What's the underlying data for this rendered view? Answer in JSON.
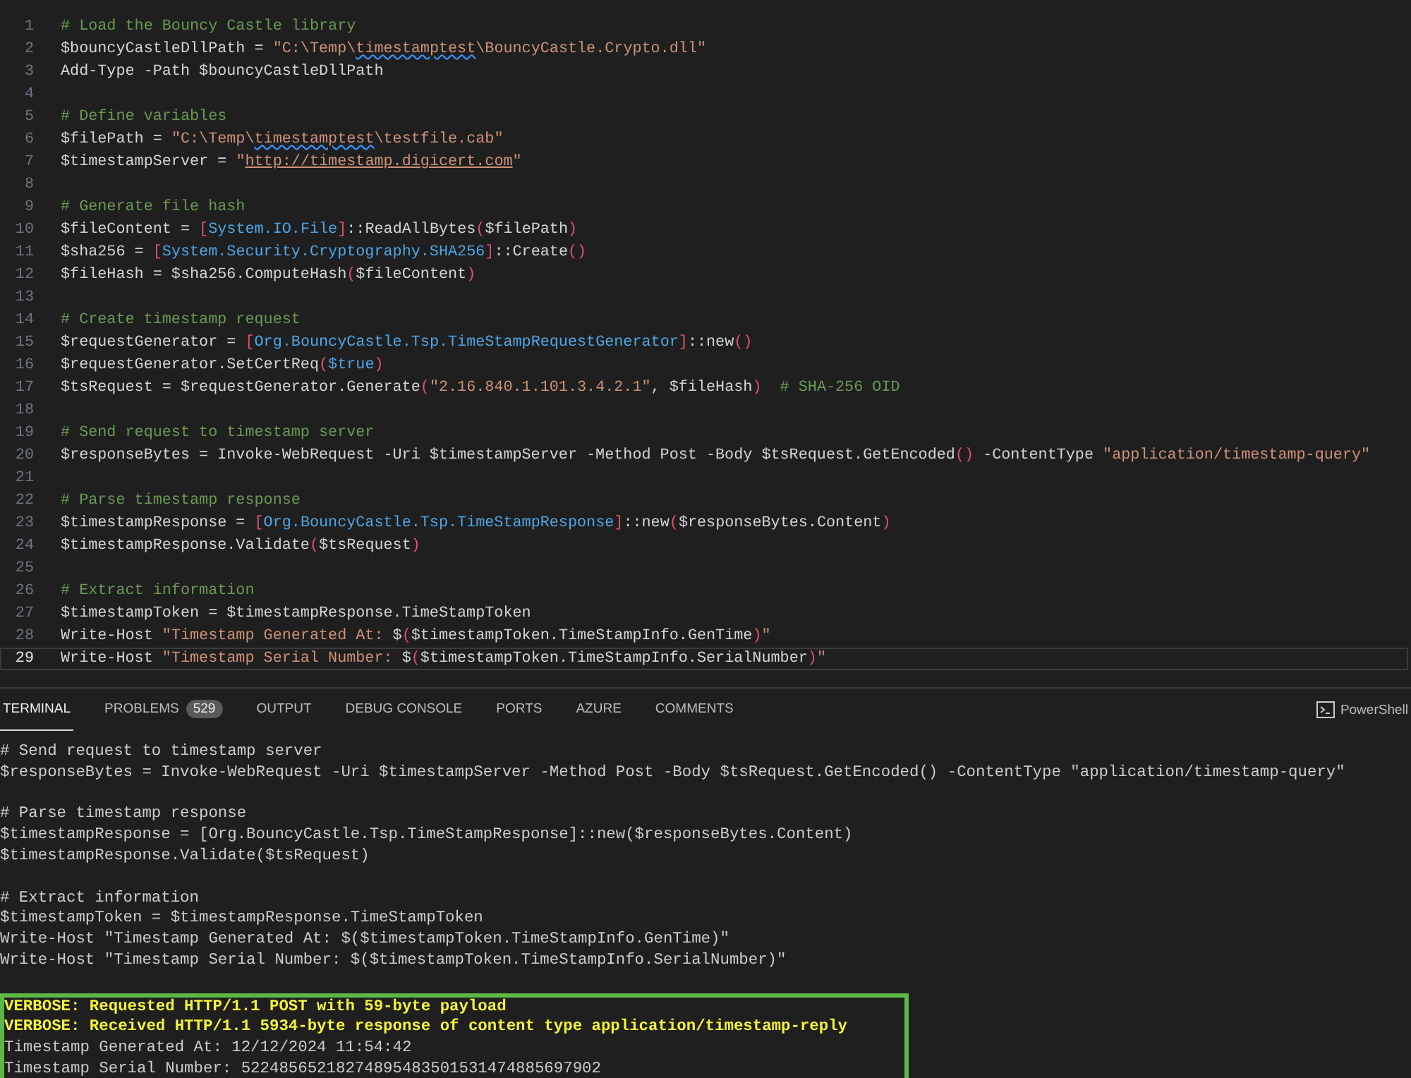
{
  "editor": {
    "lines": [
      {
        "number": "1",
        "current": false,
        "tokens": [
          {
            "kind": "comment",
            "text": "# Load the Bouncy Castle library"
          }
        ]
      },
      {
        "number": "2",
        "current": false,
        "tokens": [
          {
            "kind": "text",
            "text": "$bouncyCastleDllPath = "
          },
          {
            "kind": "string",
            "text": "\"C:\\Temp\\"
          },
          {
            "kind": "squiggle",
            "text": "timestamptest"
          },
          {
            "kind": "string",
            "text": "\\BouncyCastle.Crypto.dll\""
          }
        ]
      },
      {
        "number": "3",
        "current": false,
        "tokens": [
          {
            "kind": "text",
            "text": "Add-Type -Path $bouncyCastleDllPath"
          }
        ]
      },
      {
        "number": "4",
        "current": false
      },
      {
        "number": "5",
        "current": false,
        "tokens": [
          {
            "kind": "comment",
            "text": "# Define variables"
          }
        ]
      },
      {
        "number": "6",
        "current": false,
        "tokens": [
          {
            "kind": "text",
            "text": "$filePath = "
          },
          {
            "kind": "string",
            "text": "\"C:\\Temp\\"
          },
          {
            "kind": "squiggle",
            "text": "timestamptest"
          },
          {
            "kind": "string",
            "text": "\\testfile.cab\""
          }
        ]
      },
      {
        "number": "7",
        "current": false,
        "tokens": [
          {
            "kind": "text",
            "text": "$timestampServer = "
          },
          {
            "kind": "string",
            "text": "\""
          },
          {
            "kind": "link",
            "text": "http://timestamp.digicert.com"
          },
          {
            "kind": "string",
            "text": "\""
          }
        ]
      },
      {
        "number": "8",
        "current": false
      },
      {
        "number": "9",
        "current": false,
        "tokens": [
          {
            "kind": "comment",
            "text": "# Generate file hash"
          }
        ]
      },
      {
        "number": "10",
        "current": false,
        "tokens": [
          {
            "kind": "text",
            "text": "$fileContent = "
          },
          {
            "kind": "bracket",
            "text": "["
          },
          {
            "kind": "type",
            "text": "System.IO.File"
          },
          {
            "kind": "bracket",
            "text": "]"
          },
          {
            "kind": "text",
            "text": "::ReadAllBytes"
          },
          {
            "kind": "bracket",
            "text": "("
          },
          {
            "kind": "text",
            "text": "$filePath"
          },
          {
            "kind": "bracket",
            "text": ")"
          }
        ]
      },
      {
        "number": "11",
        "current": false,
        "tokens": [
          {
            "kind": "text",
            "text": "$sha256 = "
          },
          {
            "kind": "bracket",
            "text": "["
          },
          {
            "kind": "type",
            "text": "System.Security.Cryptography.SHA256"
          },
          {
            "kind": "bracket",
            "text": "]"
          },
          {
            "kind": "text",
            "text": "::Create"
          },
          {
            "kind": "bracket",
            "text": "()"
          }
        ]
      },
      {
        "number": "12",
        "current": false,
        "tokens": [
          {
            "kind": "text",
            "text": "$fileHash = $sha256.ComputeHash"
          },
          {
            "kind": "bracket",
            "text": "("
          },
          {
            "kind": "text",
            "text": "$fileContent"
          },
          {
            "kind": "bracket",
            "text": ")"
          }
        ]
      },
      {
        "number": "13",
        "current": false
      },
      {
        "number": "14",
        "current": false,
        "tokens": [
          {
            "kind": "comment",
            "text": "# Create timestamp request"
          }
        ]
      },
      {
        "number": "15",
        "current": false,
        "tokens": [
          {
            "kind": "text",
            "text": "$requestGenerator = "
          },
          {
            "kind": "bracket",
            "text": "["
          },
          {
            "kind": "type",
            "text": "Org.BouncyCastle.Tsp.TimeStampRequestGenerator"
          },
          {
            "kind": "bracket",
            "text": "]"
          },
          {
            "kind": "text",
            "text": "::new"
          },
          {
            "kind": "bracket",
            "text": "()"
          }
        ]
      },
      {
        "number": "16",
        "current": false,
        "tokens": [
          {
            "kind": "text",
            "text": "$requestGenerator.SetCertReq"
          },
          {
            "kind": "bracket",
            "text": "("
          },
          {
            "kind": "type",
            "text": "$true"
          },
          {
            "kind": "bracket",
            "text": ")"
          }
        ]
      },
      {
        "number": "17",
        "current": false,
        "tokens": [
          {
            "kind": "text",
            "text": "$tsRequest = $requestGenerator.Generate"
          },
          {
            "kind": "bracket",
            "text": "("
          },
          {
            "kind": "string",
            "text": "\"2.16.840.1.101.3.4.2.1\""
          },
          {
            "kind": "text",
            "text": ", $fileHash"
          },
          {
            "kind": "bracket",
            "text": ")"
          },
          {
            "kind": "comment",
            "text": "  # SHA-256 OID"
          }
        ]
      },
      {
        "number": "18",
        "current": false
      },
      {
        "number": "19",
        "current": false,
        "tokens": [
          {
            "kind": "comment",
            "text": "# Send request to timestamp server"
          }
        ]
      },
      {
        "number": "20",
        "current": false,
        "tokens": [
          {
            "kind": "text",
            "text": "$responseBytes = Invoke-WebRequest -Uri $timestampServer -Method Post -Body $tsRequest.GetEncoded"
          },
          {
            "kind": "bracket",
            "text": "()"
          },
          {
            "kind": "text",
            "text": " -ContentType "
          },
          {
            "kind": "string",
            "text": "\"application/timestamp-query\""
          }
        ]
      },
      {
        "number": "21",
        "current": false
      },
      {
        "number": "22",
        "current": false,
        "tokens": [
          {
            "kind": "comment",
            "text": "# Parse timestamp response"
          }
        ]
      },
      {
        "number": "23",
        "current": false,
        "tokens": [
          {
            "kind": "text",
            "text": "$timestampResponse = "
          },
          {
            "kind": "bracket",
            "text": "["
          },
          {
            "kind": "type",
            "text": "Org.BouncyCastle.Tsp.TimeStampResponse"
          },
          {
            "kind": "bracket",
            "text": "]"
          },
          {
            "kind": "text",
            "text": "::new"
          },
          {
            "kind": "bracket",
            "text": "("
          },
          {
            "kind": "text",
            "text": "$responseBytes.Content"
          },
          {
            "kind": "bracket",
            "text": ")"
          }
        ]
      },
      {
        "number": "24",
        "current": false,
        "tokens": [
          {
            "kind": "text",
            "text": "$timestampResponse.Validate"
          },
          {
            "kind": "bracket",
            "text": "("
          },
          {
            "kind": "text",
            "text": "$tsRequest"
          },
          {
            "kind": "bracket",
            "text": ")"
          }
        ]
      },
      {
        "number": "25",
        "current": false
      },
      {
        "number": "26",
        "current": false,
        "tokens": [
          {
            "kind": "comment",
            "text": "# Extract information"
          }
        ]
      },
      {
        "number": "27",
        "current": false,
        "tokens": [
          {
            "kind": "text",
            "text": "$timestampToken = $timestampResponse.TimeStampToken"
          }
        ]
      },
      {
        "number": "28",
        "current": false,
        "tokens": [
          {
            "kind": "text",
            "text": "Write-Host "
          },
          {
            "kind": "string",
            "text": "\"Timestamp Generated At: "
          },
          {
            "kind": "text",
            "text": "$"
          },
          {
            "kind": "bracket",
            "text": "("
          },
          {
            "kind": "text",
            "text": "$timestampToken.TimeStampInfo.GenTime"
          },
          {
            "kind": "bracket",
            "text": ")"
          },
          {
            "kind": "string",
            "text": "\""
          }
        ]
      },
      {
        "number": "29",
        "current": true,
        "tokens": [
          {
            "kind": "text",
            "text": "Write-Host "
          },
          {
            "kind": "string",
            "text": "\"Timestamp Serial Number: "
          },
          {
            "kind": "text",
            "text": "$"
          },
          {
            "kind": "bracket",
            "text": "("
          },
          {
            "kind": "text",
            "text": "$timestampToken.TimeStampInfo.SerialNumber"
          },
          {
            "kind": "bracket",
            "text": ")"
          },
          {
            "kind": "string",
            "text": "\""
          }
        ]
      }
    ]
  },
  "panel": {
    "tabs": [
      {
        "label": "TERMINAL",
        "selected": true
      },
      {
        "label": "PROBLEMS",
        "selected": false,
        "badge": "529"
      },
      {
        "label": "OUTPUT",
        "selected": false
      },
      {
        "label": "DEBUG CONSOLE",
        "selected": false
      },
      {
        "label": "PORTS",
        "selected": false
      },
      {
        "label": "AZURE",
        "selected": false
      },
      {
        "label": "COMMENTS",
        "selected": false
      }
    ],
    "shell": "PowerShell"
  },
  "terminal": {
    "blocks": [
      [
        "# Send request to timestamp server",
        "$responseBytes = Invoke-WebRequest -Uri $timestampServer -Method Post -Body $tsRequest.GetEncoded() -ContentType \"application/timestamp-query\""
      ],
      [
        "# Parse timestamp response",
        "$timestampResponse = [Org.BouncyCastle.Tsp.TimeStampResponse]::new($responseBytes.Content)",
        "$timestampResponse.Validate($tsRequest)"
      ],
      [
        "# Extract information",
        "$timestampToken = $timestampResponse.TimeStampToken",
        "Write-Host \"Timestamp Generated At: $($timestampToken.TimeStampInfo.GenTime)\"",
        "Write-Host \"Timestamp Serial Number: $($timestampToken.TimeStampInfo.SerialNumber)\""
      ]
    ],
    "output": [
      {
        "kind": "verbose",
        "text": "VERBOSE: Requested HTTP/1.1 POST with 59-byte payload"
      },
      {
        "kind": "verbose",
        "text": "VERBOSE: Received HTTP/1.1 5934-byte response of content type application/timestamp-reply"
      },
      {
        "kind": "plain",
        "text": "Timestamp Generated At: 12/12/2024 11:54:42"
      },
      {
        "kind": "plain",
        "text": "Timestamp Serial Number: 52248565218274895483501531474885697902"
      }
    ]
  }
}
